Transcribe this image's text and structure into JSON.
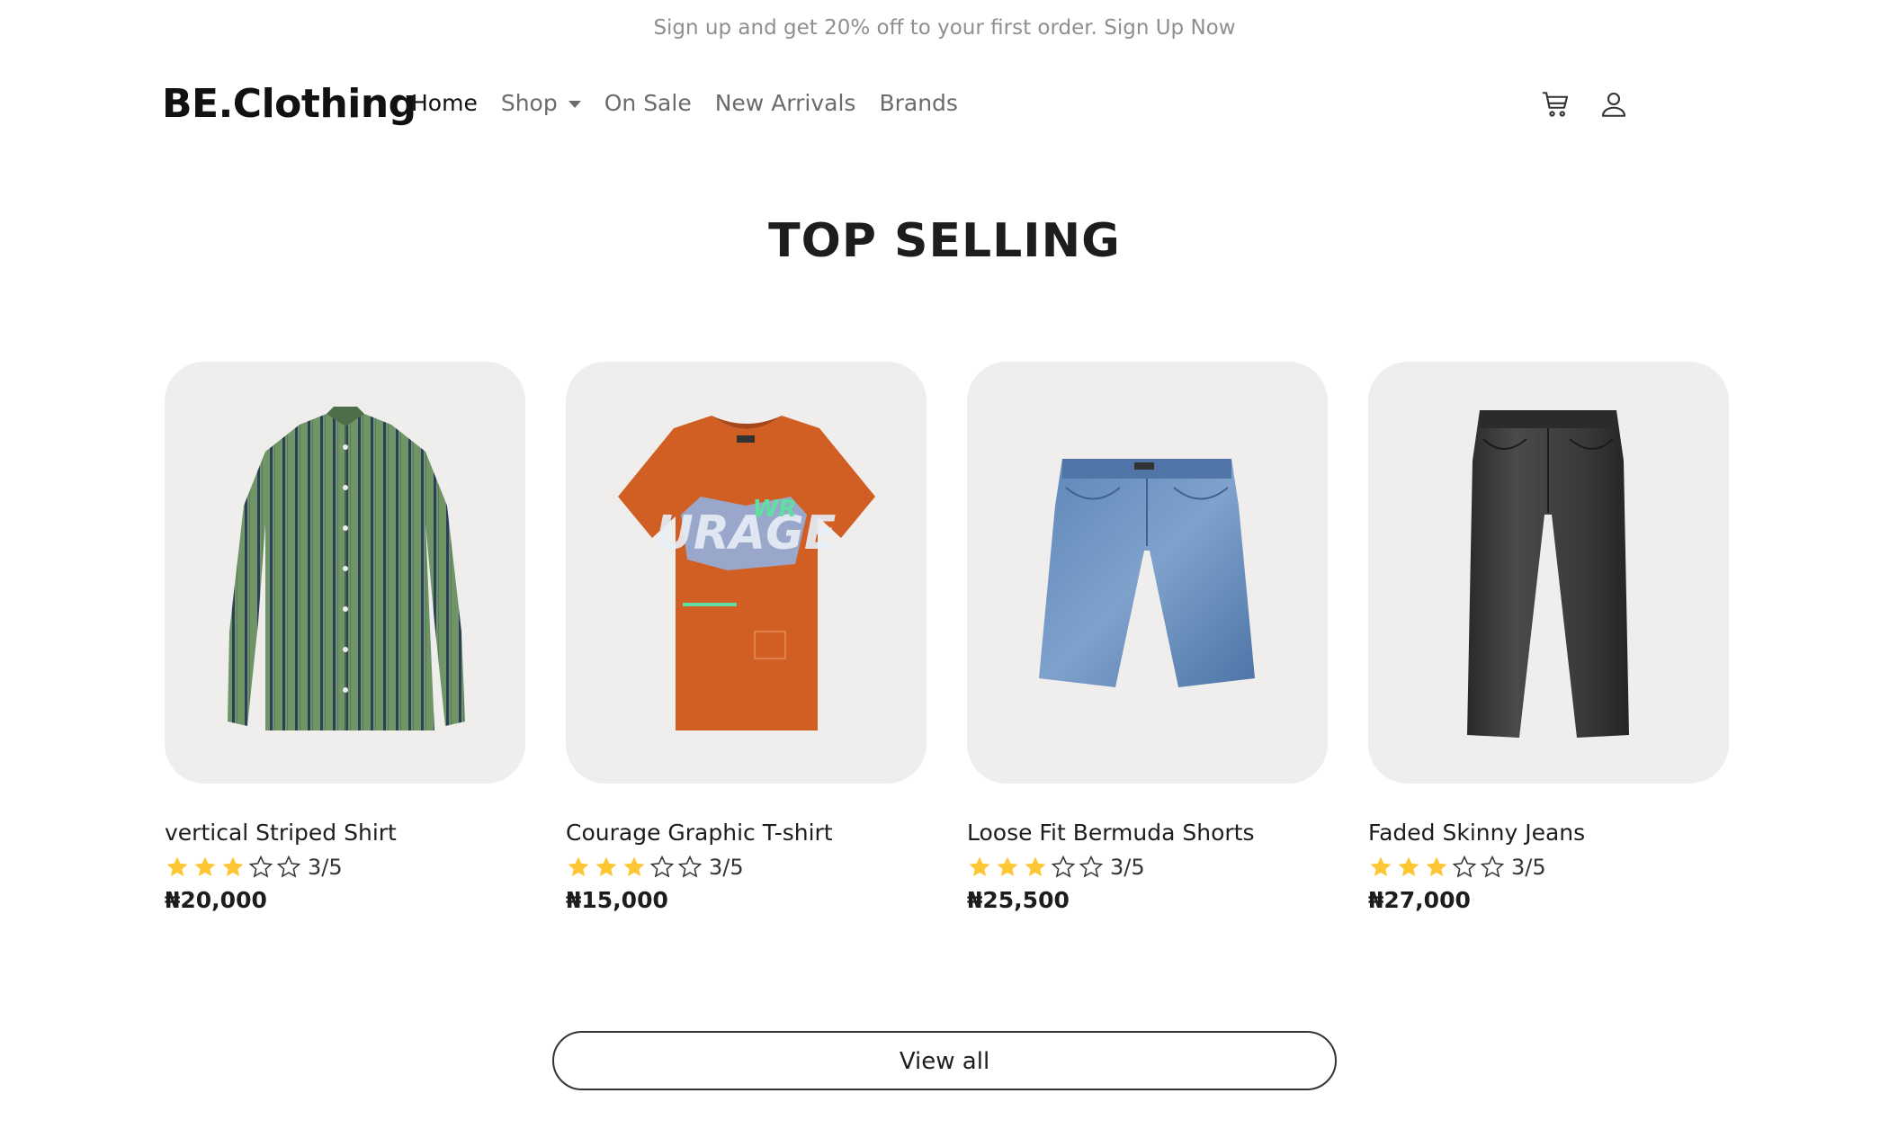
{
  "promo": {
    "text": "Sign up and get 20% off to your first order. Sign Up Now"
  },
  "nav": {
    "brand": "BE.Clothing",
    "links": [
      {
        "label": "Home",
        "active": true
      },
      {
        "label": "Shop",
        "dropdown": true
      },
      {
        "label": "On Sale"
      },
      {
        "label": "New Arrivals"
      },
      {
        "label": "Brands"
      }
    ],
    "icons": [
      "cart-icon",
      "user-icon"
    ]
  },
  "section": {
    "title": "TOP SELLING"
  },
  "products": [
    {
      "name": "vertical Striped Shirt",
      "rating": 3,
      "rating_max": 5,
      "rating_text": "3/5",
      "price": "₦20,000",
      "image": "green-striped-shirt"
    },
    {
      "name": "Courage Graphic T-shirt",
      "rating": 3,
      "rating_max": 5,
      "rating_text": "3/5",
      "price": "₦15,000",
      "image": "orange-graphic-tshirt"
    },
    {
      "name": "Loose Fit Bermuda Shorts",
      "rating": 3,
      "rating_max": 5,
      "rating_text": "3/5",
      "price": "₦25,500",
      "image": "denim-bermuda-shorts"
    },
    {
      "name": "Faded Skinny Jeans",
      "rating": 3,
      "rating_max": 5,
      "rating_text": "3/5",
      "price": "₦27,000",
      "image": "black-skinny-jeans"
    }
  ],
  "view_all": {
    "label": "View all"
  },
  "colors": {
    "star": "#FFC633",
    "card_bg": "#EFEEEC",
    "promo_text": "#8F8F8F"
  }
}
